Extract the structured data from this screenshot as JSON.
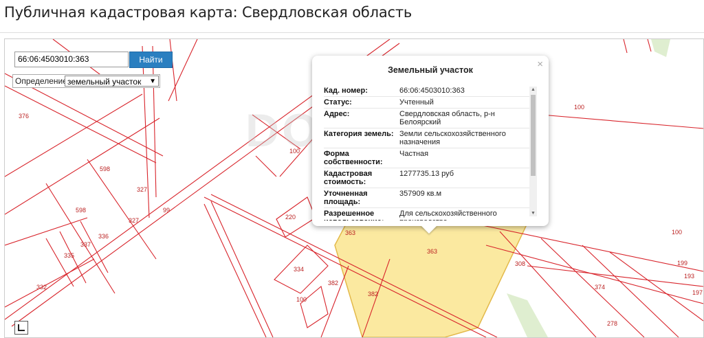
{
  "page": {
    "title": "Публичная кадастровая карта: Свердловская область"
  },
  "search": {
    "value": "66:06:4503010:363",
    "button_label": "Найти"
  },
  "definition": {
    "label": "Определение:",
    "selected": "земельный участок"
  },
  "popup": {
    "title": "Земельный участок",
    "close": "×",
    "rows": [
      {
        "key": "Кад. номер:",
        "value": "66:06:4503010:363"
      },
      {
        "key": "Статус:",
        "value": "Учтенный"
      },
      {
        "key": "Адрес:",
        "value": "Свердловская область, р-н Белоярский"
      },
      {
        "key": "Категория земель:",
        "value": "Земли сельскохозяйственного назначения"
      },
      {
        "key": "Форма собственности:",
        "value": "Частная"
      },
      {
        "key": "Кадастровая стоимость:",
        "value": "1277735.13 руб"
      },
      {
        "key": "Уточненная площадь:",
        "value": "357909 кв.м"
      },
      {
        "key": "Разрешенное использование:",
        "value": "Для сельскохозяйственного производства"
      }
    ]
  },
  "watermark": "DOMOS",
  "map_labels": {
    "l376": "376",
    "l598a": "598",
    "l327a": "327",
    "l598b": "598",
    "l327b": "327",
    "l336": "336",
    "l337": "337",
    "l335": "335",
    "l332": "332",
    "l99": "99",
    "l100a": "100",
    "l220": "220",
    "l363a": "363",
    "l363b": "363",
    "l334": "334",
    "l382a": "382",
    "l382b": "382",
    "l100b": "100",
    "l308": "308",
    "l374": "374",
    "l278": "278",
    "l199": "199",
    "l193": "193",
    "l197": "197",
    "l100c": "100",
    "l100d": "100"
  },
  "colors": {
    "parcel_line": "#d8232a",
    "selected_fill": "#fbe9a0",
    "button": "#2a7fc0"
  }
}
